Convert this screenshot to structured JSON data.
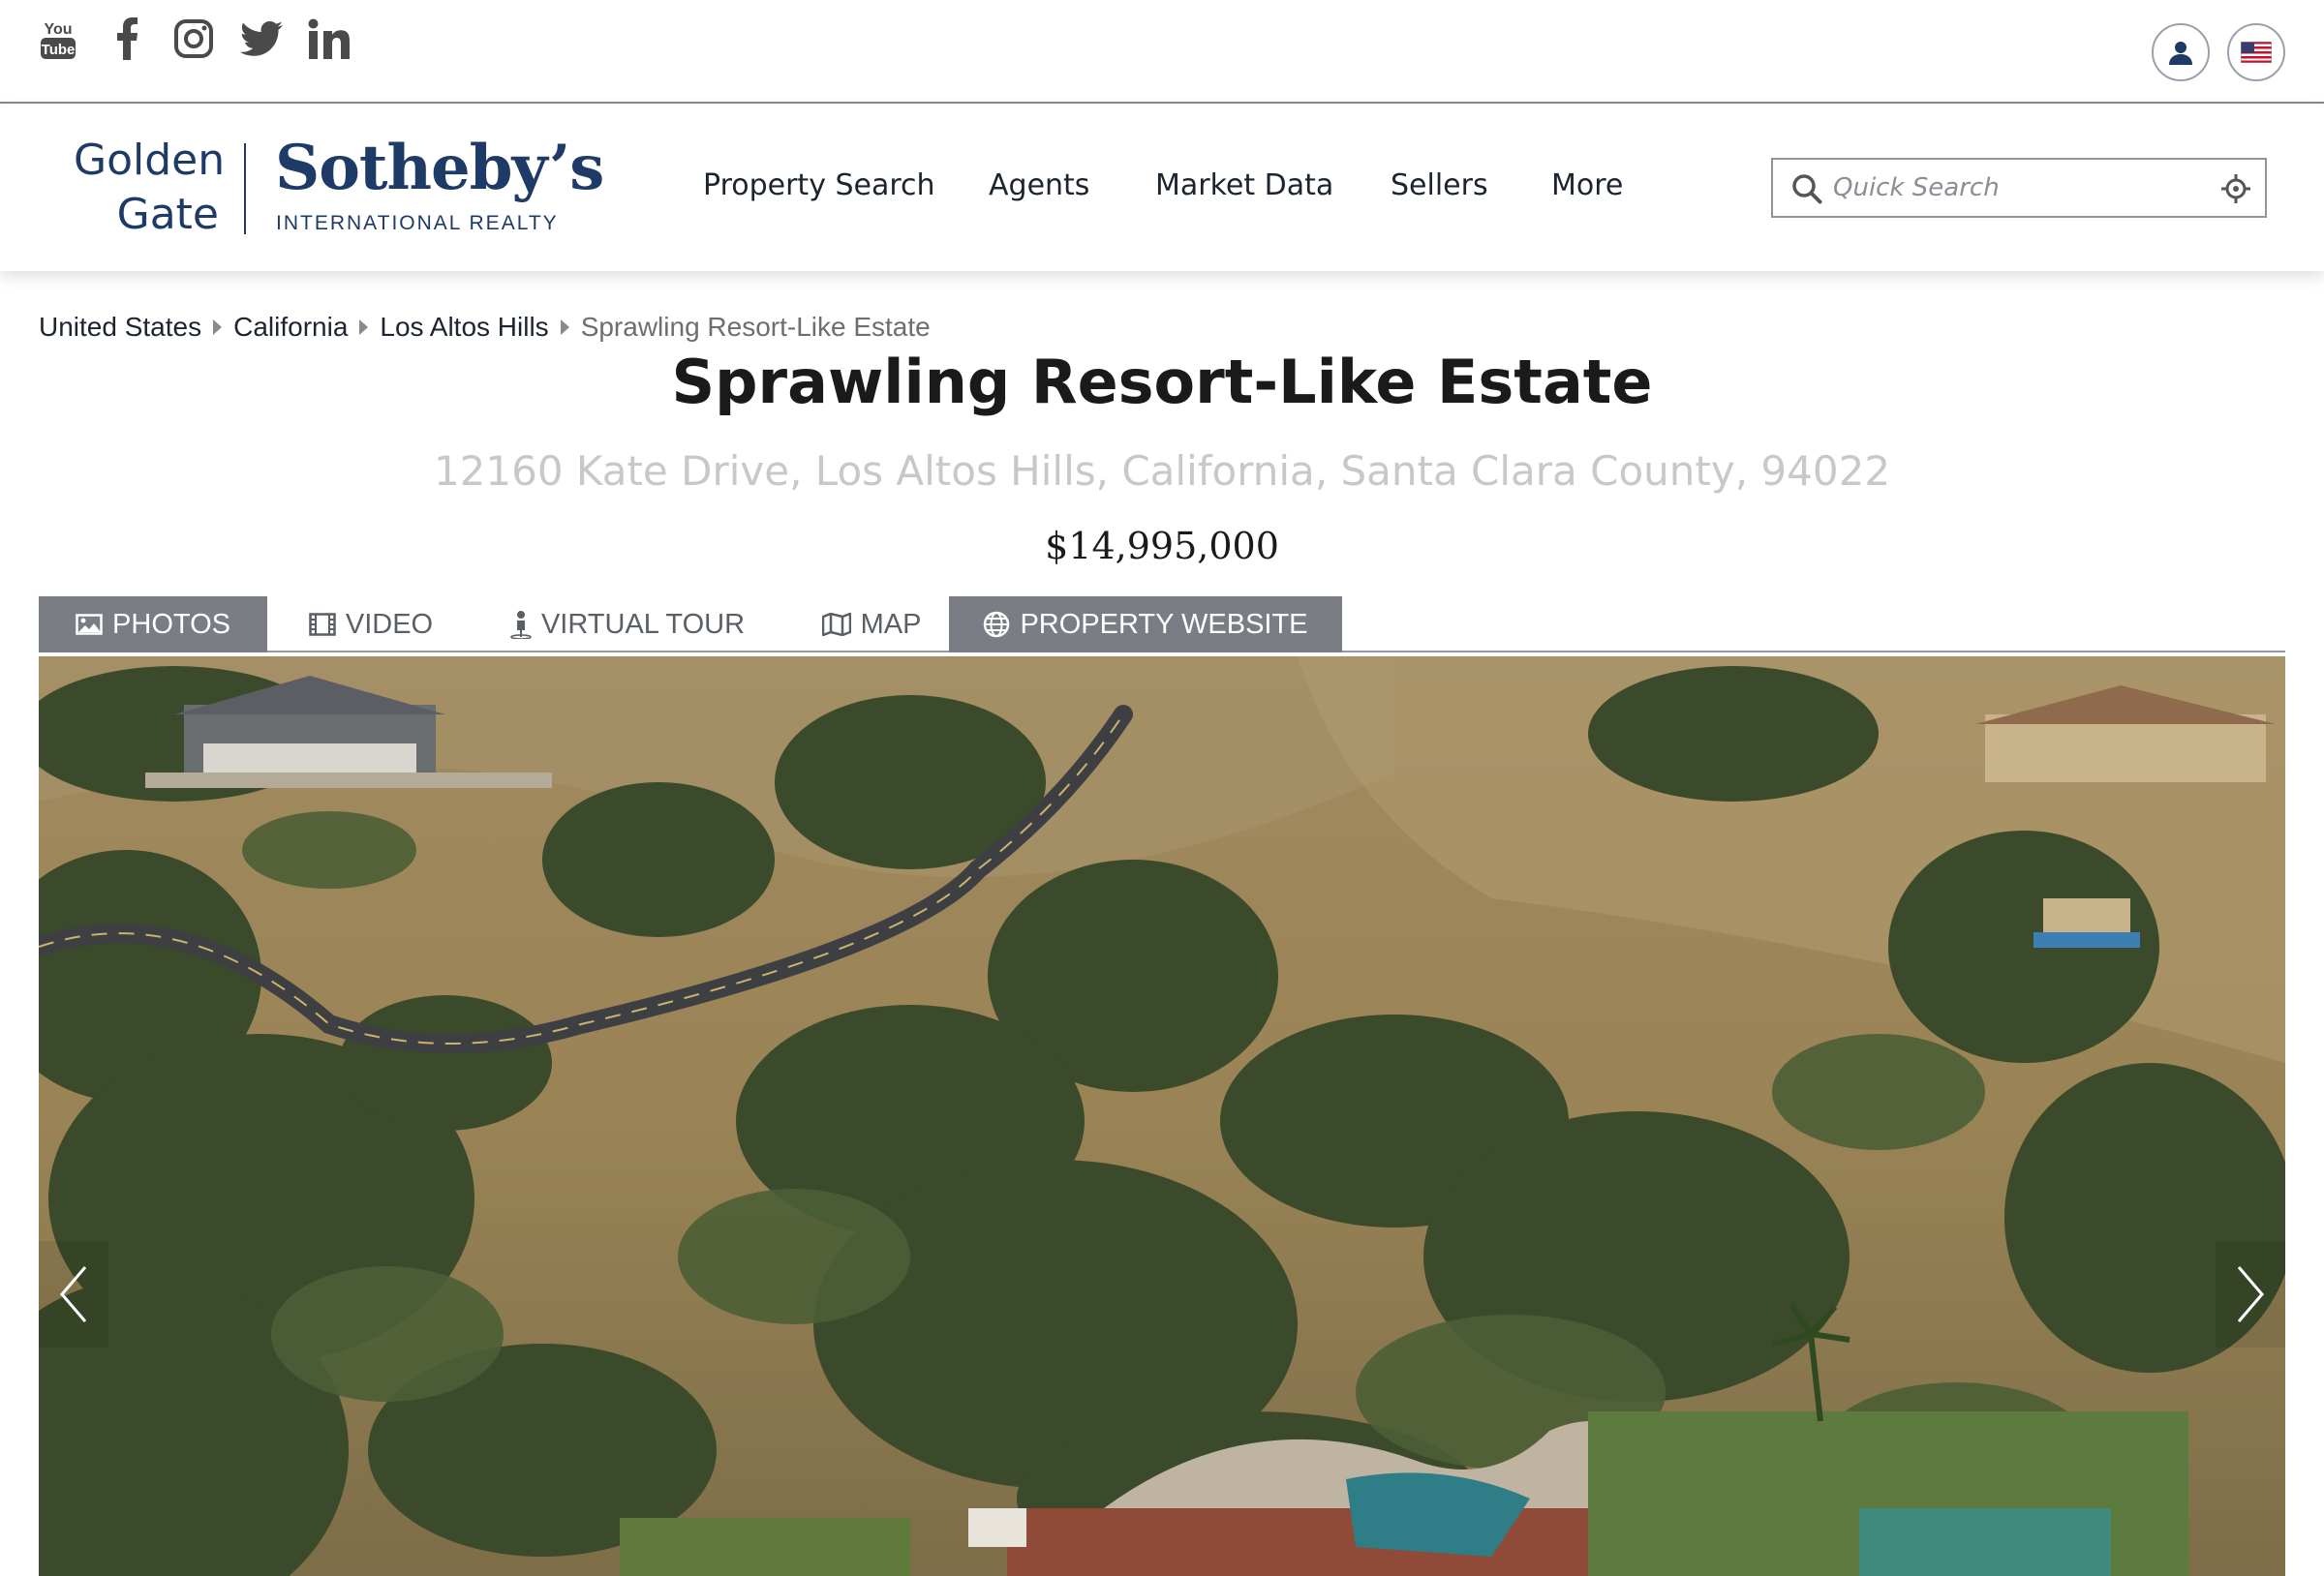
{
  "social": {
    "youtube_icon": "youtube-icon",
    "facebook_icon": "facebook-icon",
    "instagram_icon": "instagram-icon",
    "twitter_icon": "twitter-icon",
    "linkedin_icon": "linkedin-icon"
  },
  "account": {
    "user_icon": "user-icon",
    "language_icon": "us-flag-icon"
  },
  "brand": {
    "golden_line1": "Golden",
    "golden_line2": "Gate",
    "name": "Sotheby’s",
    "tagline": "INTERNATIONAL REALTY",
    "color": "#1e3a66"
  },
  "nav": {
    "items": [
      {
        "label": "Property Search"
      },
      {
        "label": "Agents"
      },
      {
        "label": "Market Data"
      },
      {
        "label": "Sellers"
      },
      {
        "label": "More"
      }
    ]
  },
  "search": {
    "placeholder": "Quick Search",
    "value": ""
  },
  "breadcrumb": {
    "items": [
      "United States",
      "California",
      "Los Altos Hills"
    ],
    "current": "Sprawling Resort-Like Estate"
  },
  "listing": {
    "title": "Sprawling Resort-Like Estate",
    "address": "12160 Kate Drive, Los Altos Hills, California, Santa Clara County, 94022",
    "price": "$14,995,000"
  },
  "media_tabs": {
    "photos": "PHOTOS",
    "video": "VIDEO",
    "virtual_tour": "VIRTUAL TOUR",
    "map": "MAP",
    "property_website": "PROPERTY WEBSITE",
    "active": "PHOTOS"
  },
  "colors": {
    "tab_active_bg": "#7a7e84",
    "header_text": "#1c2430",
    "address_text": "#c8c8c8"
  }
}
